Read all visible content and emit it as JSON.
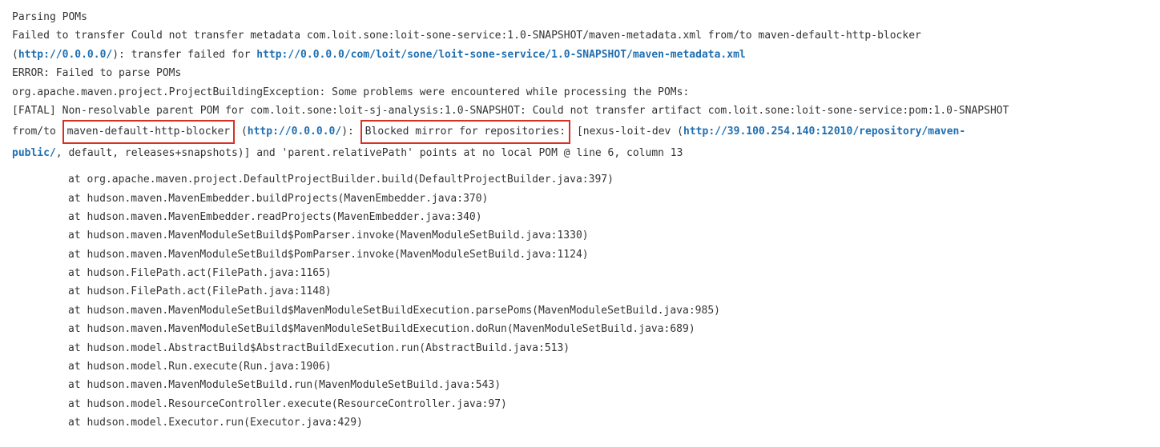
{
  "lines": {
    "l1": "Parsing POMs",
    "l2a": "Failed to transfer Could not transfer metadata com.loit.sone:loit-sone-service:1.0-SNAPSHOT/maven-metadata.xml from/to maven-default-http-blocker",
    "l3a": "(",
    "l3link1": "http://0.0.0.0/",
    "l3b": "): transfer failed for ",
    "l3link2": "http://0.0.0.0/com/loit/sone/loit-sone-service/1.0-SNAPSHOT/maven-metadata.xml",
    "l4": "ERROR: Failed to parse POMs",
    "l5": "org.apache.maven.project.ProjectBuildingException: Some problems were encountered while processing the POMs:",
    "l6": "[FATAL] Non-resolvable parent POM for com.loit.sone:loit-sj-analysis:1.0-SNAPSHOT: Could not transfer artifact com.loit.sone:loit-sone-service:pom:1.0-SNAPSHOT",
    "l7a": "from/to ",
    "l7box1": "maven-default-http-blocker",
    "l7b": " (",
    "l7link1": "http://0.0.0.0/",
    "l7c": "): ",
    "l7box2": "Blocked mirror for repositories:",
    "l7d": " [nexus-loit-dev (",
    "l7link2": "http://39.100.254.140:12010/repository/maven-",
    "l8link": "public/",
    "l8b": ", default, releases+snapshots)] and 'parent.relativePath' points at no local POM @ line 6, column 13"
  },
  "stack": [
    "at org.apache.maven.project.DefaultProjectBuilder.build(DefaultProjectBuilder.java:397)",
    "at hudson.maven.MavenEmbedder.buildProjects(MavenEmbedder.java:370)",
    "at hudson.maven.MavenEmbedder.readProjects(MavenEmbedder.java:340)",
    "at hudson.maven.MavenModuleSetBuild$PomParser.invoke(MavenModuleSetBuild.java:1330)",
    "at hudson.maven.MavenModuleSetBuild$PomParser.invoke(MavenModuleSetBuild.java:1124)",
    "at hudson.FilePath.act(FilePath.java:1165)",
    "at hudson.FilePath.act(FilePath.java:1148)",
    "at hudson.maven.MavenModuleSetBuild$MavenModuleSetBuildExecution.parsePoms(MavenModuleSetBuild.java:985)",
    "at hudson.maven.MavenModuleSetBuild$MavenModuleSetBuildExecution.doRun(MavenModuleSetBuild.java:689)",
    "at hudson.model.AbstractBuild$AbstractBuildExecution.run(AbstractBuild.java:513)",
    "at hudson.model.Run.execute(Run.java:1906)",
    "at hudson.maven.MavenModuleSetBuild.run(MavenModuleSetBuild.java:543)",
    "at hudson.model.ResourceController.execute(ResourceController.java:97)",
    "at hudson.model.Executor.run(Executor.java:429)"
  ]
}
